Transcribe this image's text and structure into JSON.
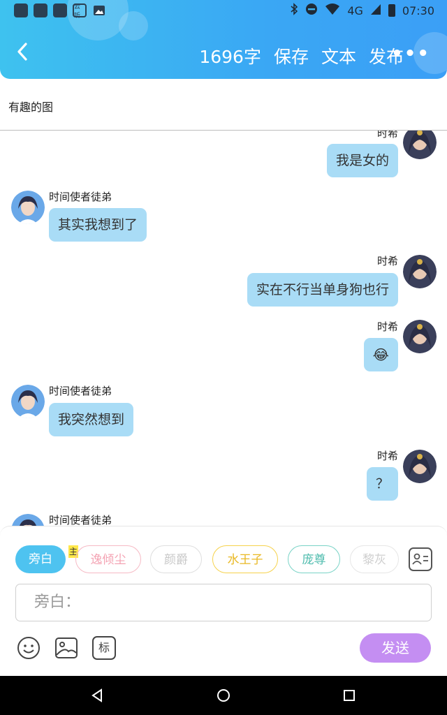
{
  "status_bar": {
    "time": "07:30",
    "network": "4G",
    "left_icons": [
      "app-icon",
      "app-icon",
      "app-icon",
      "cloud-listen-icon",
      "image-icon"
    ],
    "right_icons": [
      "bluetooth-icon",
      "dnd-icon",
      "wifi-icon",
      "signal-icon",
      "battery-icon"
    ],
    "cloud_app_label": "云听"
  },
  "header": {
    "word_count": "1696字",
    "save_label": "保存",
    "text_label": "文本",
    "publish_label": "发布",
    "more_label": "•••",
    "gradient_colors": [
      "#3ec2ef",
      "#3b9ff6"
    ]
  },
  "subtitle": "有趣的图",
  "messages": [
    {
      "side": "right",
      "name": "时希",
      "text": "我是女的"
    },
    {
      "side": "left",
      "name": "时间使者徒弟",
      "text": "其实我想到了"
    },
    {
      "side": "right",
      "name": "时希",
      "text": "实在不行当单身狗也行"
    },
    {
      "side": "right",
      "name": "时希",
      "text": "😂"
    },
    {
      "side": "left",
      "name": "时间使者徒弟",
      "text": "我突然想到"
    },
    {
      "side": "right",
      "name": "时希",
      "text": "？"
    },
    {
      "side": "left",
      "name": "时间使者徒弟",
      "text": ""
    }
  ],
  "composer": {
    "roles": [
      {
        "label": "旁白",
        "selected": true,
        "color": "#4ec3f0"
      },
      {
        "label": "逸倾尘",
        "selected": false,
        "color": "#f6b9c4"
      },
      {
        "label": "颜爵",
        "selected": false,
        "color": "#dedede"
      },
      {
        "label": "水王子",
        "selected": false,
        "color": "#f6d24b"
      },
      {
        "label": "庞尊",
        "selected": false,
        "color": "#79d3c6"
      },
      {
        "label": "黎灰",
        "selected": false,
        "color": "#dedede"
      }
    ],
    "main_tag": "主",
    "input_placeholder": "旁白：",
    "tools": [
      "emoji-icon",
      "image-icon",
      "tag-icon"
    ],
    "tag_label": "标",
    "send_label": "发送",
    "send_color": "#c48ef2"
  }
}
